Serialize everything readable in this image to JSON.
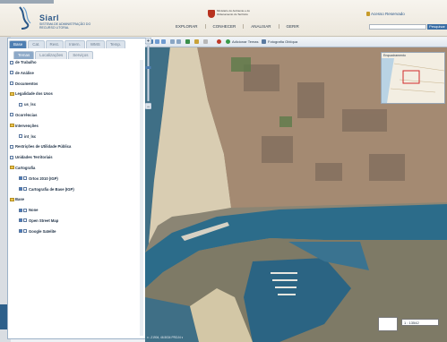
{
  "header": {
    "brand": "Siarl",
    "brand_subtitle": "SISTEMA DE ADMINISTRAÇÃO DO RECURSO LITORAL",
    "ministry": "Ministério do Ambiente e do Ordenamento do Território",
    "restricted_link": "Acesso Reservado",
    "nav": [
      "EXPLORAR",
      "CONHECER",
      "ANALISAR",
      "GERIR"
    ],
    "search_placeholder": "",
    "search_button": "Pesquisar"
  },
  "panel": {
    "tabs_top": [
      "Base",
      "Cat.",
      "Rest.",
      "Intern.",
      "WMS",
      "Temp."
    ],
    "tabs_sub": [
      "Temas",
      "Localizações",
      "Serviços"
    ],
    "tree": [
      {
        "label": "de Trabalho",
        "indent": 0,
        "icon": "checkbox"
      },
      {
        "label": "de Análise",
        "indent": 0,
        "icon": "checkbox"
      },
      {
        "label": "Documentos",
        "indent": 0,
        "icon": "checkbox"
      },
      {
        "label": "Legalidade dos Usos",
        "indent": 0,
        "icon": "folder"
      },
      {
        "label": "us_lsc",
        "indent": 2,
        "icon": "checkbox"
      },
      {
        "label": "Ocorrências",
        "indent": 0,
        "icon": "checkbox"
      },
      {
        "label": "Intervenções",
        "indent": 0,
        "icon": "folder"
      },
      {
        "label": "int_lsc",
        "indent": 2,
        "icon": "checkbox"
      },
      {
        "label": "Restrições de Utilidade Pública",
        "indent": 0,
        "icon": "checkbox"
      },
      {
        "label": "Unidades Territoriais",
        "indent": 0,
        "icon": "checkbox"
      },
      {
        "label": "Cartografia",
        "indent": 0,
        "icon": "folder"
      },
      {
        "label": "Ortos 2010 (IGP)",
        "indent": 2,
        "icon": "checked"
      },
      {
        "label": "Cartografia de Base (IGP)",
        "indent": 2,
        "icon": "checked"
      },
      {
        "label": "Base",
        "indent": 0,
        "icon": "folder"
      },
      {
        "label": "None",
        "indent": 2,
        "icon": "checked"
      },
      {
        "label": "Open Street Map",
        "indent": 2,
        "icon": "checked"
      },
      {
        "label": "Google Satelite",
        "indent": 2,
        "icon": "checked"
      }
    ]
  },
  "map": {
    "toolbar": {
      "add_themes": "Adicionar Temas",
      "ortho": "Fotografia Oblíqua"
    },
    "overview_title": "Enquadramento",
    "scale": "1 : 13542",
    "coords": "x: -21904, 46.5034 PROJ4 ▾"
  },
  "colors": {
    "accent": "#3b6fa6",
    "panel_border": "#9db2c8",
    "water": "#2c6c8a"
  }
}
